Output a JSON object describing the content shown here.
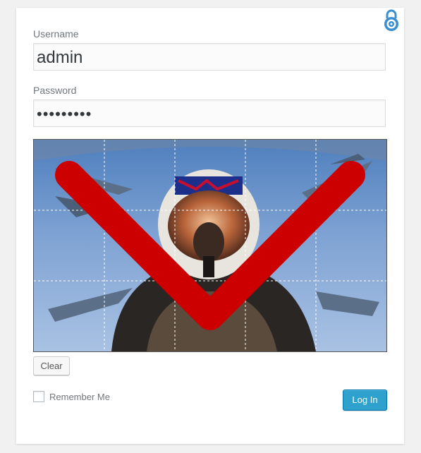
{
  "form": {
    "username_label": "Username",
    "username_value": "admin",
    "password_label": "Password",
    "password_value": "•••••••••",
    "clear_label": "Clear",
    "remember_label": "Remember Me",
    "remember_checked": false,
    "login_label": "Log In"
  },
  "icons": {
    "lock": "padlock-icon"
  },
  "picture_password": {
    "grid_columns": 5,
    "grid_rows": 3,
    "gesture": "checkmark",
    "gesture_color": "#cc0000"
  },
  "colors": {
    "accent": "#2ea2cc",
    "lock": "#3a8fd0"
  }
}
